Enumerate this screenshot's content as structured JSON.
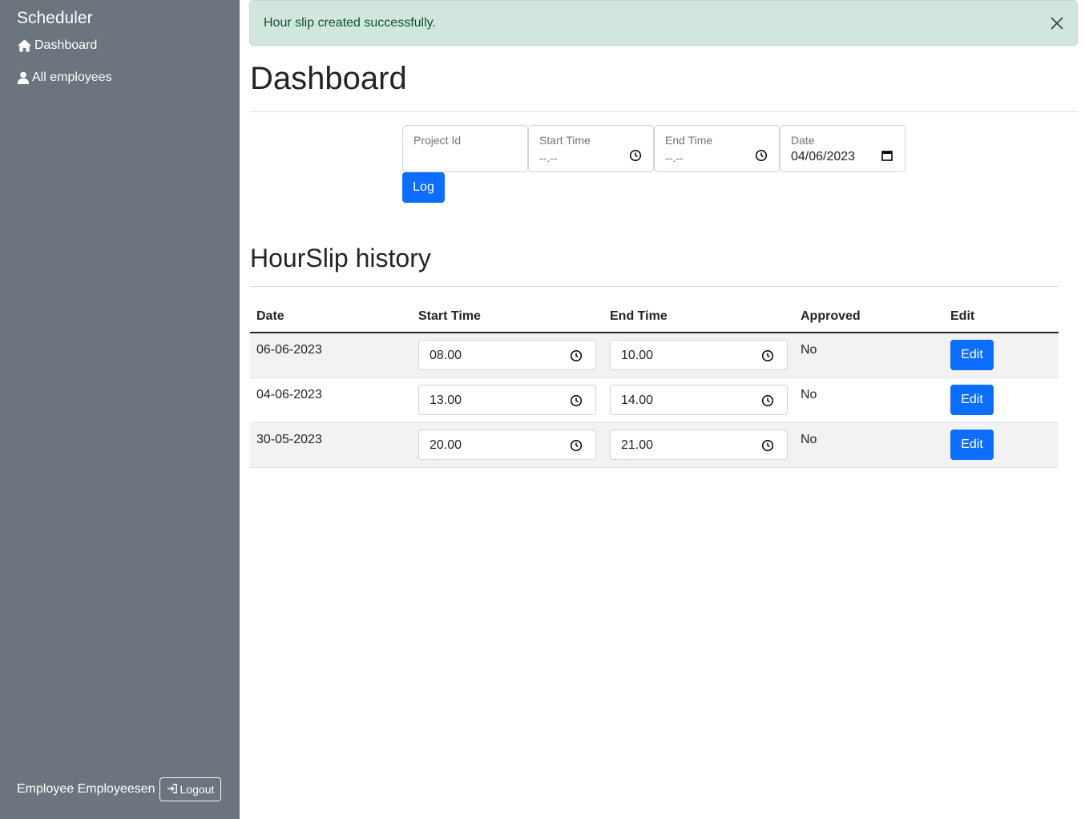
{
  "sidebar": {
    "brand": "Scheduler",
    "nav": [
      {
        "label": "Dashboard",
        "icon": "home-icon"
      },
      {
        "label": "All employees",
        "icon": "user-icon"
      }
    ],
    "user_name": "Employee Employeesen",
    "logout_label": "Logout"
  },
  "alert": {
    "message": "Hour slip created successfully."
  },
  "page_title": "Dashboard",
  "form": {
    "project_label": "Project Id",
    "start_label": "Start Time",
    "start_value": "--.--",
    "end_label": "End Time",
    "end_value": "--.--",
    "date_label": "Date",
    "date_value": "04/06/2023",
    "log_label": "Log"
  },
  "history": {
    "title": "HourSlip history",
    "columns": [
      "Date",
      "Start Time",
      "End Time",
      "Approved",
      "Edit"
    ],
    "rows": [
      {
        "date": "06-06-2023",
        "start": "08.00",
        "end": "10.00",
        "approved": "No",
        "edit": "Edit"
      },
      {
        "date": "04-06-2023",
        "start": "13.00",
        "end": "14.00",
        "approved": "No",
        "edit": "Edit"
      },
      {
        "date": "30-05-2023",
        "start": "20.00",
        "end": "21.00",
        "approved": "No",
        "edit": "Edit"
      }
    ]
  },
  "colors": {
    "sidebar": "#6c757d",
    "primary": "#0d6efd",
    "alert_bg": "#d1e7dd",
    "alert_text": "#0f5132"
  }
}
